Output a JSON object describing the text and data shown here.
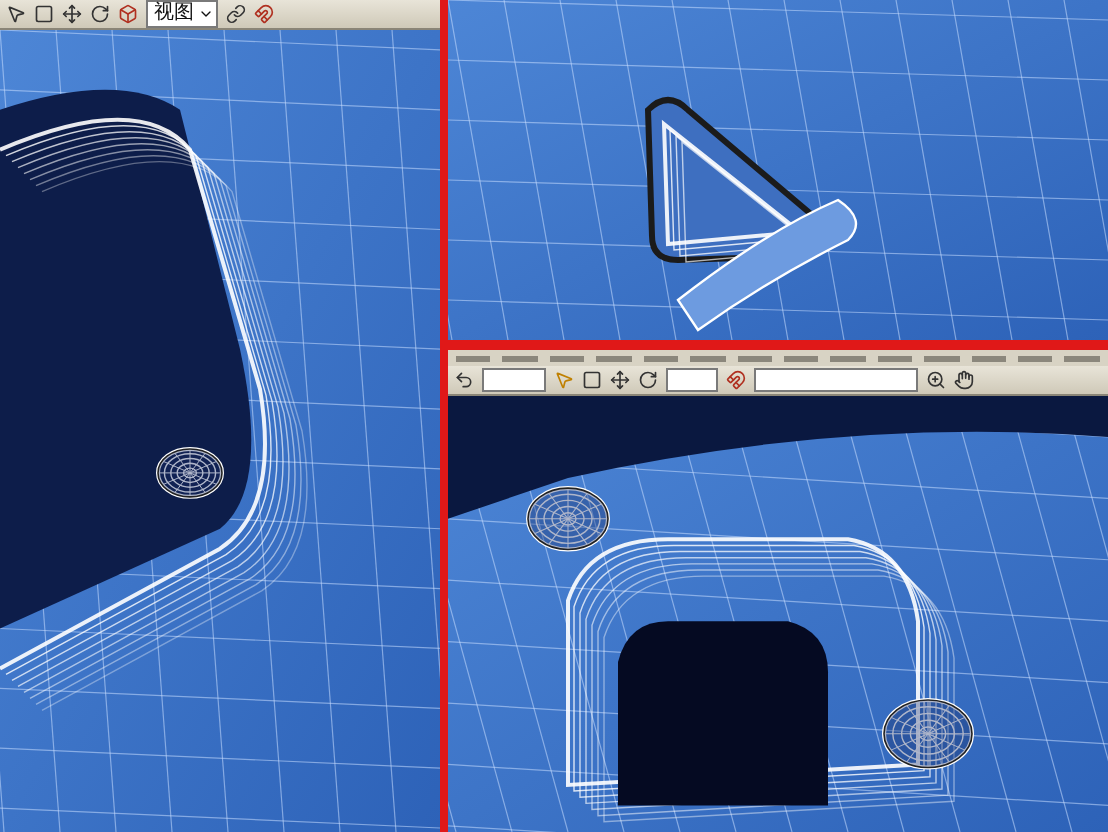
{
  "left_panel": {
    "toolbar": {
      "view_dropdown": "视图"
    },
    "viewport": {
      "kind": "handle-corner"
    }
  },
  "right_top_panel": {
    "viewport": {
      "kind": "triangle-button"
    }
  },
  "right_bottom_panel": {
    "viewport": {
      "kind": "socket-holes"
    }
  }
}
